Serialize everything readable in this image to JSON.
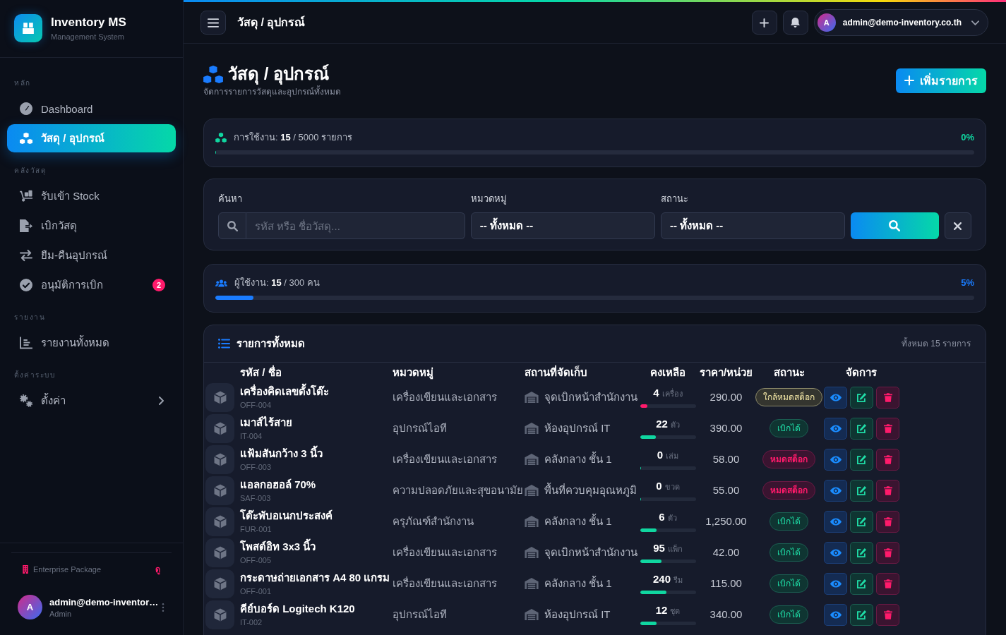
{
  "sidebar": {
    "brand": {
      "name": "Inventory MS",
      "tagline": "Management System"
    },
    "sections": [
      {
        "label": "หลัก",
        "items": [
          {
            "kind": "link",
            "label": "Dashboard",
            "selected": false
          },
          {
            "kind": "link",
            "label": "วัสดุ / อุปกรณ์",
            "selected": true
          }
        ]
      },
      {
        "label": "คลังวัสดุ",
        "items": [
          {
            "kind": "link",
            "label": "รับเข้า Stock",
            "selected": false
          },
          {
            "kind": "link",
            "label": "เบิกวัสดุ",
            "selected": false
          },
          {
            "kind": "link",
            "label": "ยืม-คืนอุปกรณ์",
            "selected": false
          },
          {
            "kind": "link",
            "label": "อนุมัติการเบิก",
            "selected": false,
            "badge": "2"
          }
        ]
      },
      {
        "label": "รายงาน",
        "items": [
          {
            "kind": "link",
            "label": "รายงานทั้งหมด",
            "selected": false
          }
        ]
      },
      {
        "label": "ตั้งค่าระบบ",
        "items": [
          {
            "kind": "submenu",
            "label": "ตั้งค่า",
            "selected": false
          }
        ]
      }
    ],
    "package": {
      "label": "Enterprise Package",
      "link": "ดู"
    },
    "user": {
      "initial": "A",
      "name": "admin@demo-inventor…",
      "role": "Admin"
    }
  },
  "topbar": {
    "title": "วัสดุ / อุปกรณ์",
    "user": {
      "initial": "A",
      "email": "admin@demo-inventory.co.th"
    }
  },
  "page": {
    "title": "วัสดุ / อุปกรณ์",
    "subtitle": "จัดการรายการวัสดุและอุปกรณ์ทั้งหมด",
    "add_button": "เพิ่มรายการ"
  },
  "item_quota": {
    "text": "การใช้งาน: **15** / 5000 รายการ",
    "percent": "0%",
    "level": 0
  },
  "filters": {
    "search": {
      "label": "ค้นหา",
      "placeholder": "รหัส หรือ ชื่อวัสดุ..."
    },
    "category": {
      "label": "หมวดหมู่",
      "value": "-- ทั้งหมด --"
    },
    "status": {
      "label": "สถานะ",
      "value": "-- ทั้งหมด --"
    }
  },
  "user_quota": {
    "text": "ผู้ใช้งาน: **15** / 300 คน",
    "percent": "5%",
    "level": 0.05
  },
  "table": {
    "title": "รายการทั้งหมด",
    "total": "ทั้งหมด 15 รายการ",
    "columns": [
      "รหัส / ชื่อ",
      "หมวดหมู่",
      "สถานที่จัดเก็บ",
      "คงเหลือ",
      "ราคา/หน่วย",
      "สถานะ",
      "จัดการ"
    ],
    "rows": [
      {
        "name": "เครื่องคิดเลขตั้งโต๊ะ",
        "code": "OFF-004",
        "category": "เครื่องเขียนและเอกสาร",
        "location": "จุดเบิกหน้าสำนักงาน",
        "qty": "4",
        "unit": "เครื่อง",
        "level": 0.13,
        "price": "290.00",
        "status": {
          "kind": "low",
          "label": "ใกล้หมดสต็อก"
        }
      },
      {
        "name": "เมาส์ไร้สาย",
        "code": "IT-004",
        "category": "อุปกรณ์ไอที",
        "location": "ห้องอุปกรณ์ IT",
        "qty": "22",
        "unit": "ตัว",
        "level": 0.28,
        "price": "390.00",
        "status": {
          "kind": "available",
          "label": "เบิกได้"
        }
      },
      {
        "name": "แฟ้มสันกว้าง 3 นิ้ว",
        "code": "OFF-003",
        "category": "เครื่องเขียนและเอกสาร",
        "location": "คลังกลาง ชั้น 1",
        "qty": "0",
        "unit": "เล่ม",
        "level": 0,
        "price": "58.00",
        "status": {
          "kind": "out",
          "label": "หมดสต็อก"
        }
      },
      {
        "name": "แอลกอฮอล์ 70%",
        "code": "SAF-003",
        "category": "ความปลอดภัยและสุขอนามัย",
        "location": "พื้นที่ควบคุมอุณหภูมิ",
        "qty": "0",
        "unit": "ขวด",
        "level": 0,
        "price": "55.00",
        "status": {
          "kind": "out",
          "label": "หมดสต็อก"
        }
      },
      {
        "name": "โต๊ะพับอเนกประสงค์",
        "code": "FUR-001",
        "category": "ครุภัณฑ์สำนักงาน",
        "location": "คลังกลาง ชั้น 1",
        "qty": "6",
        "unit": "ตัว",
        "level": 0.3,
        "price": "1,250.00",
        "status": {
          "kind": "available",
          "label": "เบิกได้"
        }
      },
      {
        "name": "โพสต์อิท 3x3 นิ้ว",
        "code": "OFF-005",
        "category": "เครื่องเขียนและเอกสาร",
        "location": "จุดเบิกหน้าสำนักงาน",
        "qty": "95",
        "unit": "แพ็ก",
        "level": 0.38,
        "price": "42.00",
        "status": {
          "kind": "available",
          "label": "เบิกได้"
        }
      },
      {
        "name": "กระดาษถ่ายเอกสาร A4 80 แกรม",
        "code": "OFF-001",
        "category": "เครื่องเขียนและเอกสาร",
        "location": "คลังกลาง ชั้น 1",
        "qty": "240",
        "unit": "รีม",
        "level": 0.48,
        "price": "115.00",
        "status": {
          "kind": "available",
          "label": "เบิกได้"
        }
      },
      {
        "name": "คีย์บอร์ด Logitech K120",
        "code": "IT-002",
        "category": "อุปกรณ์ไอที",
        "location": "ห้องอุปกรณ์ IT",
        "qty": "12",
        "unit": "ชุด",
        "level": 0.3,
        "price": "340.00",
        "status": {
          "kind": "available",
          "label": "เบิกได้"
        }
      }
    ]
  }
}
